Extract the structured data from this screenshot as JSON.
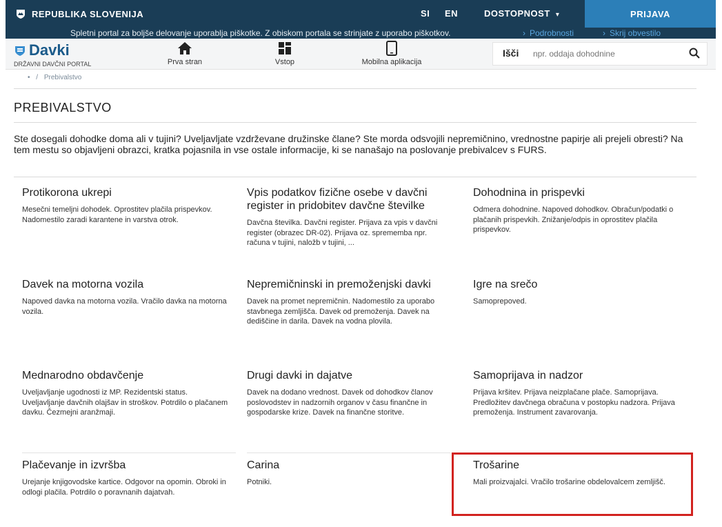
{
  "gov_bar": {
    "name": "REPUBLIKA SLOVENIJA",
    "lang_si": "SI",
    "lang_en": "EN",
    "accessibility": "DOSTOPNOST",
    "login": "PRIJAVA"
  },
  "cookie": {
    "message": "Spletni portal za boljše delovanje uporablja piškotke. Z obiskom portala se strinjate z uporabo piškotkov.",
    "details": "Podrobnosti",
    "hide": "Skrij obvestilo"
  },
  "header": {
    "brand": "Davki",
    "subtitle": "DRŽAVNI DAVČNI PORTAL",
    "nav": [
      "Prva stran",
      "Vstop",
      "Mobilna aplikacija"
    ],
    "search_label": "Išči",
    "search_placeholder": "npr. oddaja dohodnine"
  },
  "breadcrumb": {
    "current": "Prebivalstvo"
  },
  "page": {
    "title": "PREBIVALSTVO",
    "intro": "Ste dosegali dohodke doma ali v tujini? Uveljavljate vzdrževane družinske člane? Ste morda odsvojili nepremičnino, vrednostne papirje ali prejeli obresti? Na tem mestu so objavljeni obrazci, kratka pojasnila in vse ostale informacije, ki se nanašajo na poslovanje prebivalcev s FURS."
  },
  "cards": [
    {
      "title": "Protikorona ukrepi",
      "desc": "Mesečni temeljni dohodek. Oprostitev plačila prispevkov. Nadomestilo zaradi karantene in varstva otrok."
    },
    {
      "title": "Vpis podatkov fizične osebe v davčni register in pridobitev davčne številke",
      "desc": "Davčna številka. Davčni register. Prijava za vpis v davčni register (obrazec DR-02). Prijava oz. sprememba npr. računa v tujini, naložb v tujini, ..."
    },
    {
      "title": "Dohodnina in prispevki",
      "desc": "Odmera dohodnine. Napoved dohodkov. Obračun/podatki o plačanih prispevkih. Znižanje/odpis in oprostitev plačila prispevkov."
    },
    {
      "title": "Davek na motorna vozila",
      "desc": "Napoved davka na motorna vozila. Vračilo davka na motorna vozila."
    },
    {
      "title": "Nepremičninski in premoženjski davki",
      "desc": "Davek na promet nepremičnin. Nadomestilo za uporabo stavbnega zemljišča. Davek od premoženja. Davek na dediščine in darila. Davek na vodna plovila."
    },
    {
      "title": "Igre na srečo",
      "desc": "Samoprepoved."
    },
    {
      "title": "Mednarodno obdavčenje",
      "desc": "Uveljavljanje ugodnosti iz MP. Rezidentski status. Uveljavljanje davčnih olajšav in stroškov. Potrdilo o plačanem davku. Čezmejni aranžmaji."
    },
    {
      "title": "Drugi davki in dajatve",
      "desc": "Davek na dodano vrednost. Davek od dohodkov članov poslovodstev in nadzornih organov v času finančne in gospodarske krize. Davek na finančne storitve."
    },
    {
      "title": "Samoprijava in nadzor",
      "desc": "Prijava kršitev. Prijava neizplačane plače. Samoprijava. Predložitev davčnega obračuna v postopku nadzora. Prijava premoženja. Instrument zavarovanja."
    },
    {
      "title": "Plačevanje in izvršba",
      "desc": "Urejanje knjigovodske kartice. Odgovor na opomin. Obroki in odlogi plačila. Potrdilo o poravnanih dajatvah."
    },
    {
      "title": "Carina",
      "desc": "Potniki."
    },
    {
      "title": "Trošarine",
      "desc": "Mali proizvajalci. Vračilo trošarine obdelovalcem zemljišč."
    }
  ],
  "colors": {
    "top_bar": "#1a3d56",
    "login_button": "#2c7fb8",
    "brand": "#1a5a8a",
    "highlight": "#d2231f"
  }
}
